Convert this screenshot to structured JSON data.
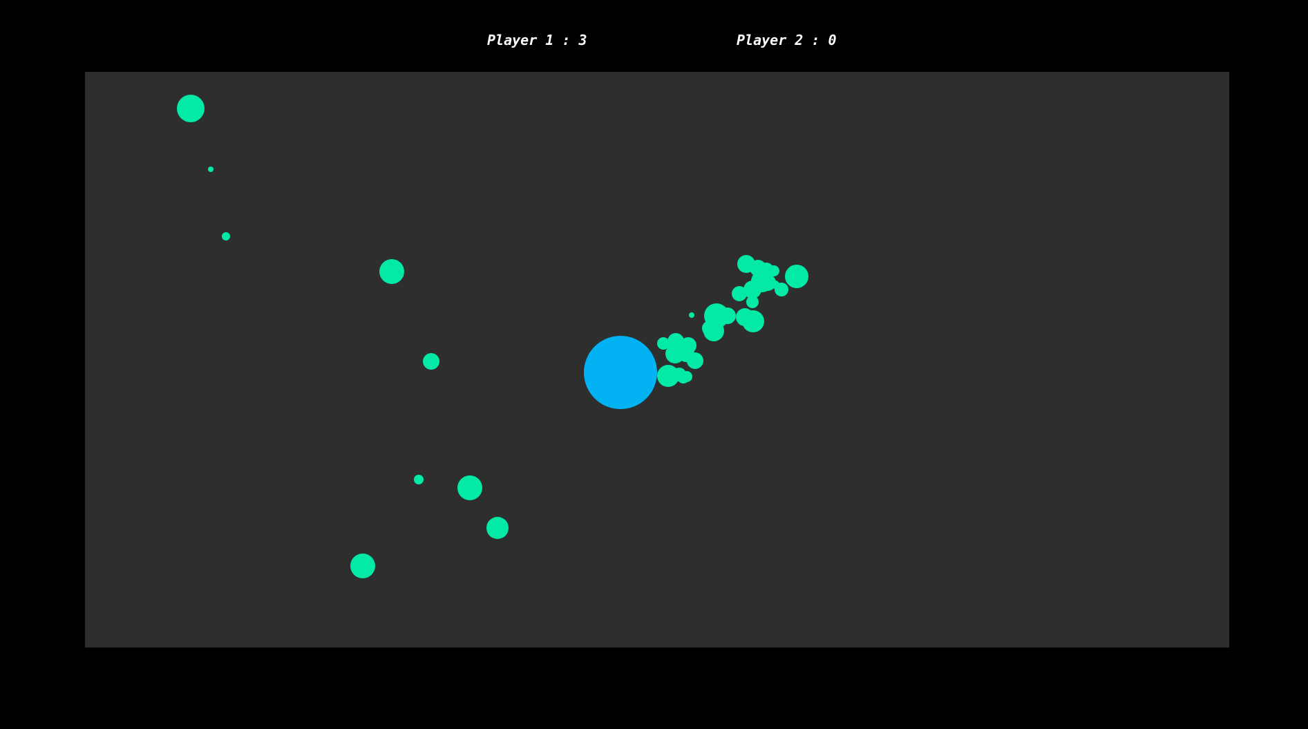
{
  "scoreboard": {
    "player1": {
      "label": "Player 1",
      "separator": " : ",
      "score": "3"
    },
    "player2": {
      "label": "Player 2",
      "separator": " : ",
      "score": "0"
    }
  },
  "colors": {
    "page_background": "#000000",
    "arena_background": "#2e2e2e",
    "particle": "#03eaa6",
    "player_ball": "#02b2f2",
    "score_text": "#ffffff"
  }
}
